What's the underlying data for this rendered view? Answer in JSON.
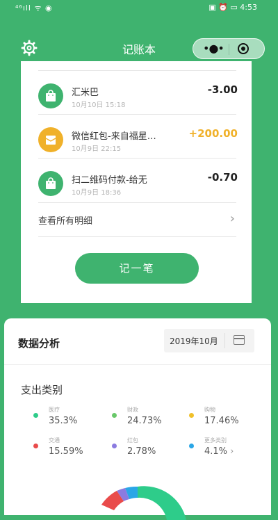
{
  "status_bar": {
    "left": "⁴⁶ıll ᯤ ◉",
    "right": "▣ ⏰ ▭ 4:53"
  },
  "nav": {
    "title": "记账本"
  },
  "transactions": [
    {
      "name": "汇米巴",
      "time": "10月10日 15:18",
      "amount": "-3.00",
      "kind": "expense"
    },
    {
      "name": "微信红包-来自福星…",
      "time": "10月9日 22:15",
      "amount": "+200.00",
      "kind": "income"
    },
    {
      "name": "扫二维码付款-给无",
      "time": "10月9日 18:36",
      "amount": "-0.70",
      "kind": "expense"
    }
  ],
  "view_all": {
    "label": "查看所有明细",
    "chevron": "›"
  },
  "record_button": {
    "label": "记一笔"
  },
  "analysis": {
    "title": "数据分析",
    "date": "2019年10月",
    "category_title": "支出类别",
    "categories": [
      {
        "name": "医疗",
        "percent": "35.3%",
        "color": "#2ecc8a"
      },
      {
        "name": "财政",
        "percent": "24.73%",
        "color": "#69c86a"
      },
      {
        "name": "购物",
        "percent": "17.46%",
        "color": "#f0c02a"
      },
      {
        "name": "交通",
        "percent": "15.59%",
        "color": "#e94b4b"
      },
      {
        "name": "红包",
        "percent": "2.78%",
        "color": "#8b7be0"
      },
      {
        "name": "更多类别",
        "percent": "4.1%",
        "suffix": "›",
        "color": "#2aa6e6"
      }
    ]
  },
  "colors": {
    "brand_green": "#3fb36f",
    "income_yellow": "#f0b12a",
    "red_envelope": "#f0b12a"
  }
}
